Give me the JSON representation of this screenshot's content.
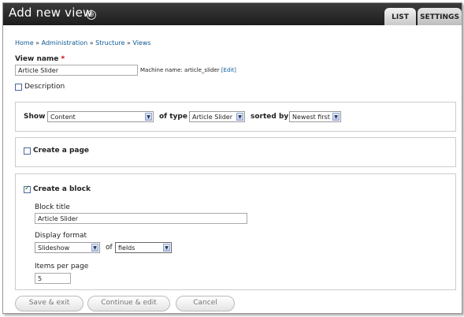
{
  "header": {
    "title": "Add new view",
    "plus_icon": "⊕",
    "tabs": [
      "LIST",
      "SETTINGS"
    ]
  },
  "breadcrumb": [
    "Home",
    "Administration",
    "Structure",
    "Views"
  ],
  "breadcrumb_sep": "»",
  "view_name": {
    "label": "View name",
    "required": "*",
    "value": "Article Slider",
    "machine_label": "Machine name: article_slider",
    "edit": "[Edit]"
  },
  "description_label": "Description",
  "show": {
    "label": "Show",
    "value": "Content",
    "type_label": "of type",
    "type_value": "Article Slider",
    "sorted_label": "sorted by",
    "sorted_value": "Newest first"
  },
  "create_page": {
    "label": "Create a page",
    "checked": false
  },
  "create_block": {
    "label": "Create a block",
    "checked": true,
    "block_title_label": "Block title",
    "block_title_value": "Article Slider",
    "display_format_label": "Display format",
    "display_format_value": "Slideshow",
    "of_label": "of",
    "of_value": "fields",
    "items_label": "Items per page",
    "items_value": "5"
  },
  "buttons": {
    "save": "Save & exit",
    "continue": "Continue & edit",
    "cancel": "Cancel"
  },
  "icons": {
    "dropdown": "chevron-down-icon",
    "check": "check-icon"
  }
}
